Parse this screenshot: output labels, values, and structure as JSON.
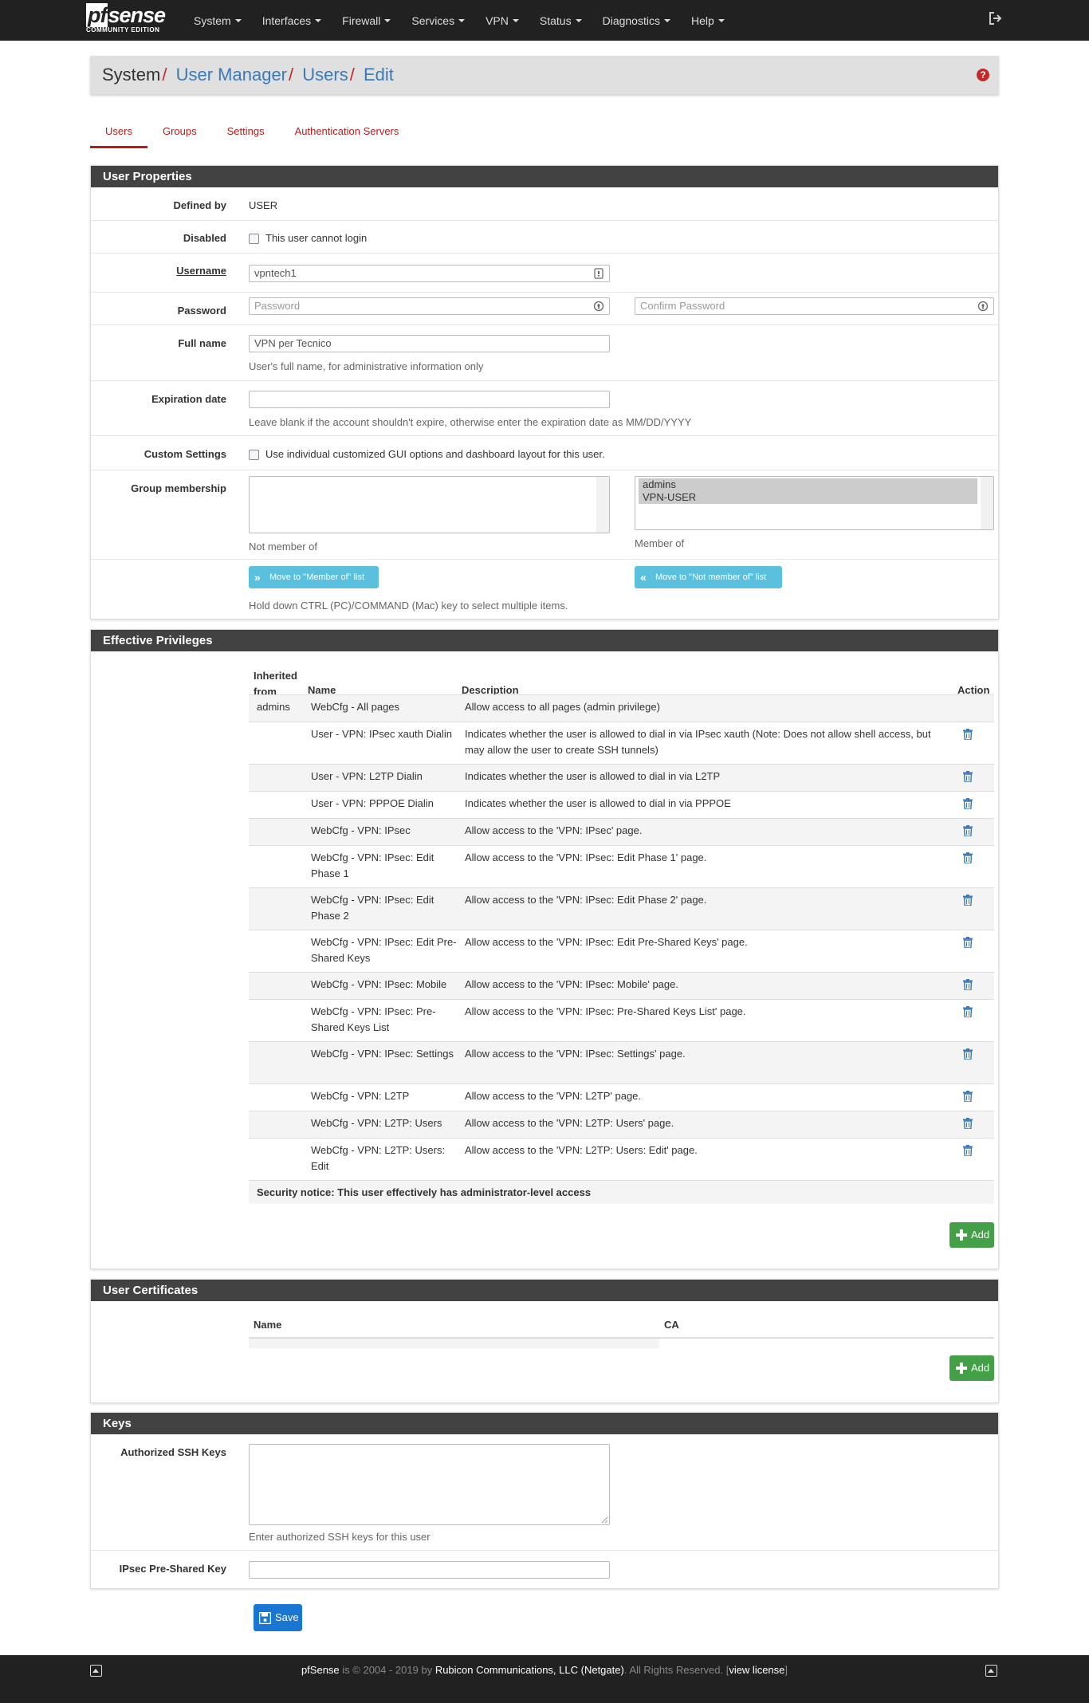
{
  "brand": {
    "logo_text": "sense",
    "logo_pf": "pf",
    "edition": "COMMUNITY EDITION"
  },
  "nav": [
    {
      "label": "System"
    },
    {
      "label": "Interfaces"
    },
    {
      "label": "Firewall"
    },
    {
      "label": "Services"
    },
    {
      "label": "VPN"
    },
    {
      "label": "Status"
    },
    {
      "label": "Diagnostics"
    },
    {
      "label": "Help"
    }
  ],
  "breadcrumb": [
    "System",
    "User Manager",
    "Users",
    "Edit"
  ],
  "tabs": [
    "Users",
    "Groups",
    "Settings",
    "Authentication Servers"
  ],
  "user_properties": {
    "title": "User Properties",
    "defined_by_label": "Defined by",
    "defined_by_value": "USER",
    "disabled_label": "Disabled",
    "disabled_text": "This user cannot login",
    "username_label": "Username",
    "username_value": "vpntech1",
    "password_label": "Password",
    "password_placeholder": "Password",
    "confirm_placeholder": "Confirm Password",
    "fullname_label": "Full name",
    "fullname_value": "VPN per Tecnico",
    "fullname_help": "User's full name, for administrative information only",
    "expiration_label": "Expiration date",
    "expiration_help": "Leave blank if the account shouldn't expire, otherwise enter the expiration date as MM/DD/YYYY",
    "custom_label": "Custom Settings",
    "custom_text": "Use individual customized GUI options and dashboard layout for this user.",
    "group_label": "Group membership",
    "not_member_caption": "Not member of",
    "member_caption": "Member of",
    "member_of": [
      "admins",
      "VPN-USER"
    ],
    "move_to_member": "Move to \"Member of\" list",
    "move_to_not_member": "Move to \"Not member of\" list",
    "multi_help": "Hold down CTRL (PC)/COMMAND (Mac) key to select multiple items."
  },
  "privileges": {
    "title": "Effective Privileges",
    "headers": {
      "inherited_1": "Inherited",
      "inherited_2": "from",
      "name": "Name",
      "description": "Description",
      "action": "Action"
    },
    "rows": [
      {
        "inherited": "admins",
        "name": "WebCfg - All pages",
        "desc": "Allow access to all pages (admin privilege)"
      },
      {
        "inherited": "",
        "name": "User - VPN: IPsec xauth Dialin",
        "desc": "Indicates whether the user is allowed to dial in via IPsec xauth (Note: Does not allow shell access, but may allow the user to create SSH tunnels)"
      },
      {
        "inherited": "",
        "name": "User - VPN: L2TP Dialin",
        "desc": "Indicates whether the user is allowed to dial in via L2TP"
      },
      {
        "inherited": "",
        "name": "User - VPN: PPPOE Dialin",
        "desc": "Indicates whether the user is allowed to dial in via PPPOE"
      },
      {
        "inherited": "",
        "name": "WebCfg - VPN: IPsec",
        "desc": "Allow access to the 'VPN: IPsec' page."
      },
      {
        "inherited": "",
        "name": "WebCfg - VPN: IPsec: Edit Phase 1",
        "desc": "Allow access to the 'VPN: IPsec: Edit Phase 1' page."
      },
      {
        "inherited": "",
        "name": "WebCfg - VPN: IPsec: Edit Phase 2",
        "desc": "Allow access to the 'VPN: IPsec: Edit Phase 2' page."
      },
      {
        "inherited": "",
        "name": "WebCfg - VPN: IPsec: Edit Pre-Shared Keys",
        "desc": "Allow access to the 'VPN: IPsec: Edit Pre-Shared Keys' page."
      },
      {
        "inherited": "",
        "name": "WebCfg - VPN: IPsec: Mobile",
        "desc": "Allow access to the 'VPN: IPsec: Mobile' page."
      },
      {
        "inherited": "",
        "name": "WebCfg - VPN: IPsec: Pre-Shared Keys List",
        "desc": "Allow access to the 'VPN: IPsec: Pre-Shared Keys List' page."
      },
      {
        "inherited": "",
        "name": "WebCfg - VPN: IPsec: Settings",
        "desc": "Allow access to the 'VPN: IPsec: Settings' page."
      },
      {
        "inherited": "",
        "name": "WebCfg - VPN: L2TP",
        "desc": "Allow access to the 'VPN: L2TP' page."
      },
      {
        "inherited": "",
        "name": "WebCfg - VPN: L2TP: Users",
        "desc": "Allow access to the 'VPN: L2TP: Users' page."
      },
      {
        "inherited": "",
        "name": "WebCfg - VPN: L2TP: Users: Edit",
        "desc": "Allow access to the 'VPN: L2TP: Users: Edit' page."
      }
    ],
    "security_notice": "Security notice: This user effectively has administrator-level access",
    "add_label": "Add"
  },
  "certificates": {
    "title": "User Certificates",
    "col_name": "Name",
    "col_ca": "CA",
    "add_label": "Add"
  },
  "keys": {
    "title": "Keys",
    "ssh_label": "Authorized SSH Keys",
    "ssh_help": "Enter authorized SSH keys for this user",
    "psk_label": "IPsec Pre-Shared Key"
  },
  "save_label": "Save",
  "footer": {
    "p1": "pfSense",
    "p2": " is © 2004 - 2019 by ",
    "p3": "Rubicon Communications, LLC (Netgate)",
    "p4": ". All Rights Reserved. [",
    "p5": "view license",
    "p6": "]"
  },
  "colors": {
    "navbar": "#212121",
    "accent": "#b71c1c",
    "link": "#3a7ab7",
    "panel_head": "#424242",
    "info_btn": "#5bc0de",
    "add_btn": "#43a047",
    "save_btn": "#1976d2"
  }
}
